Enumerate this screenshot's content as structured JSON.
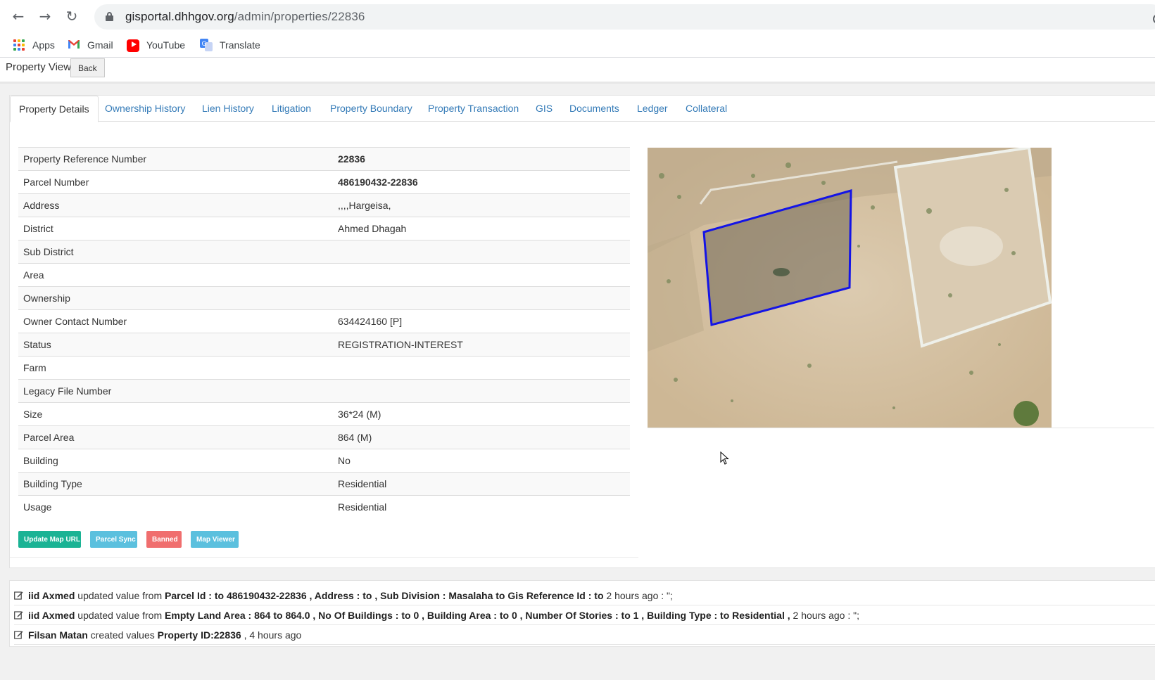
{
  "browser": {
    "url_host": "gisportal.dhhgov.org",
    "url_path": "/admin/properties/22836",
    "bookmarks": [
      "Apps",
      "Gmail",
      "YouTube",
      "Translate"
    ]
  },
  "header": {
    "title": "Property View",
    "back_label": "Back"
  },
  "tabs": [
    "Property Details",
    "Ownership History",
    "Lien History",
    "Litigation",
    "Property Boundary",
    "Property Transaction",
    "GIS",
    "Documents",
    "Ledger",
    "Collateral"
  ],
  "details": [
    {
      "label": "Property Reference Number",
      "value": "22836"
    },
    {
      "label": "Parcel Number",
      "value": "486190432-22836"
    },
    {
      "label": "Address",
      "value": ",,,,Hargeisa,"
    },
    {
      "label": "District",
      "value": "Ahmed Dhagah"
    },
    {
      "label": "Sub District",
      "value": ""
    },
    {
      "label": "Area",
      "value": ""
    },
    {
      "label": "Ownership",
      "value": ""
    },
    {
      "label": "Owner Contact Number",
      "value": "634424160 [P]"
    },
    {
      "label": "Status",
      "value": "REGISTRATION-INTEREST"
    },
    {
      "label": "Farm",
      "value": ""
    },
    {
      "label": "Legacy File Number",
      "value": ""
    },
    {
      "label": "Size",
      "value": "36*24 (M)"
    },
    {
      "label": "Parcel Area",
      "value": "864 (M)"
    },
    {
      "label": "Building",
      "value": "No"
    },
    {
      "label": "Building Type",
      "value": "Residential"
    },
    {
      "label": "Usage",
      "value": "Residential"
    }
  ],
  "actions": {
    "update_map_url": "Update Map URL",
    "parcel_sync": "Parcel Sync",
    "banned": "Banned",
    "map_viewer": "Map Viewer"
  },
  "colors": {
    "green": "#1ab394",
    "blue": "#5bc0de",
    "red": "#f06e6e",
    "link": "#337ab7",
    "parcel_outline": "#1414e6"
  },
  "log": [
    {
      "user": "iid Axmed",
      "verb": " updated value from ",
      "changes": "Parcel Id : to 486190432-22836 , Address : to , Sub Division : Masalaha to Gis Reference Id : to",
      "time": " 2 hours ago : \";"
    },
    {
      "user": "iid Axmed",
      "verb": " updated value from ",
      "changes": "Empty Land Area : 864 to 864.0 , No Of Buildings : to 0 , Building Area : to 0 , Number Of Stories : to 1 , Building Type : to Residential ,",
      "time": " 2 hours ago : \";"
    },
    {
      "user": "Filsan Matan",
      "verb": " created values ",
      "changes": "Property ID:22836",
      "time": " , 4 hours ago"
    }
  ]
}
